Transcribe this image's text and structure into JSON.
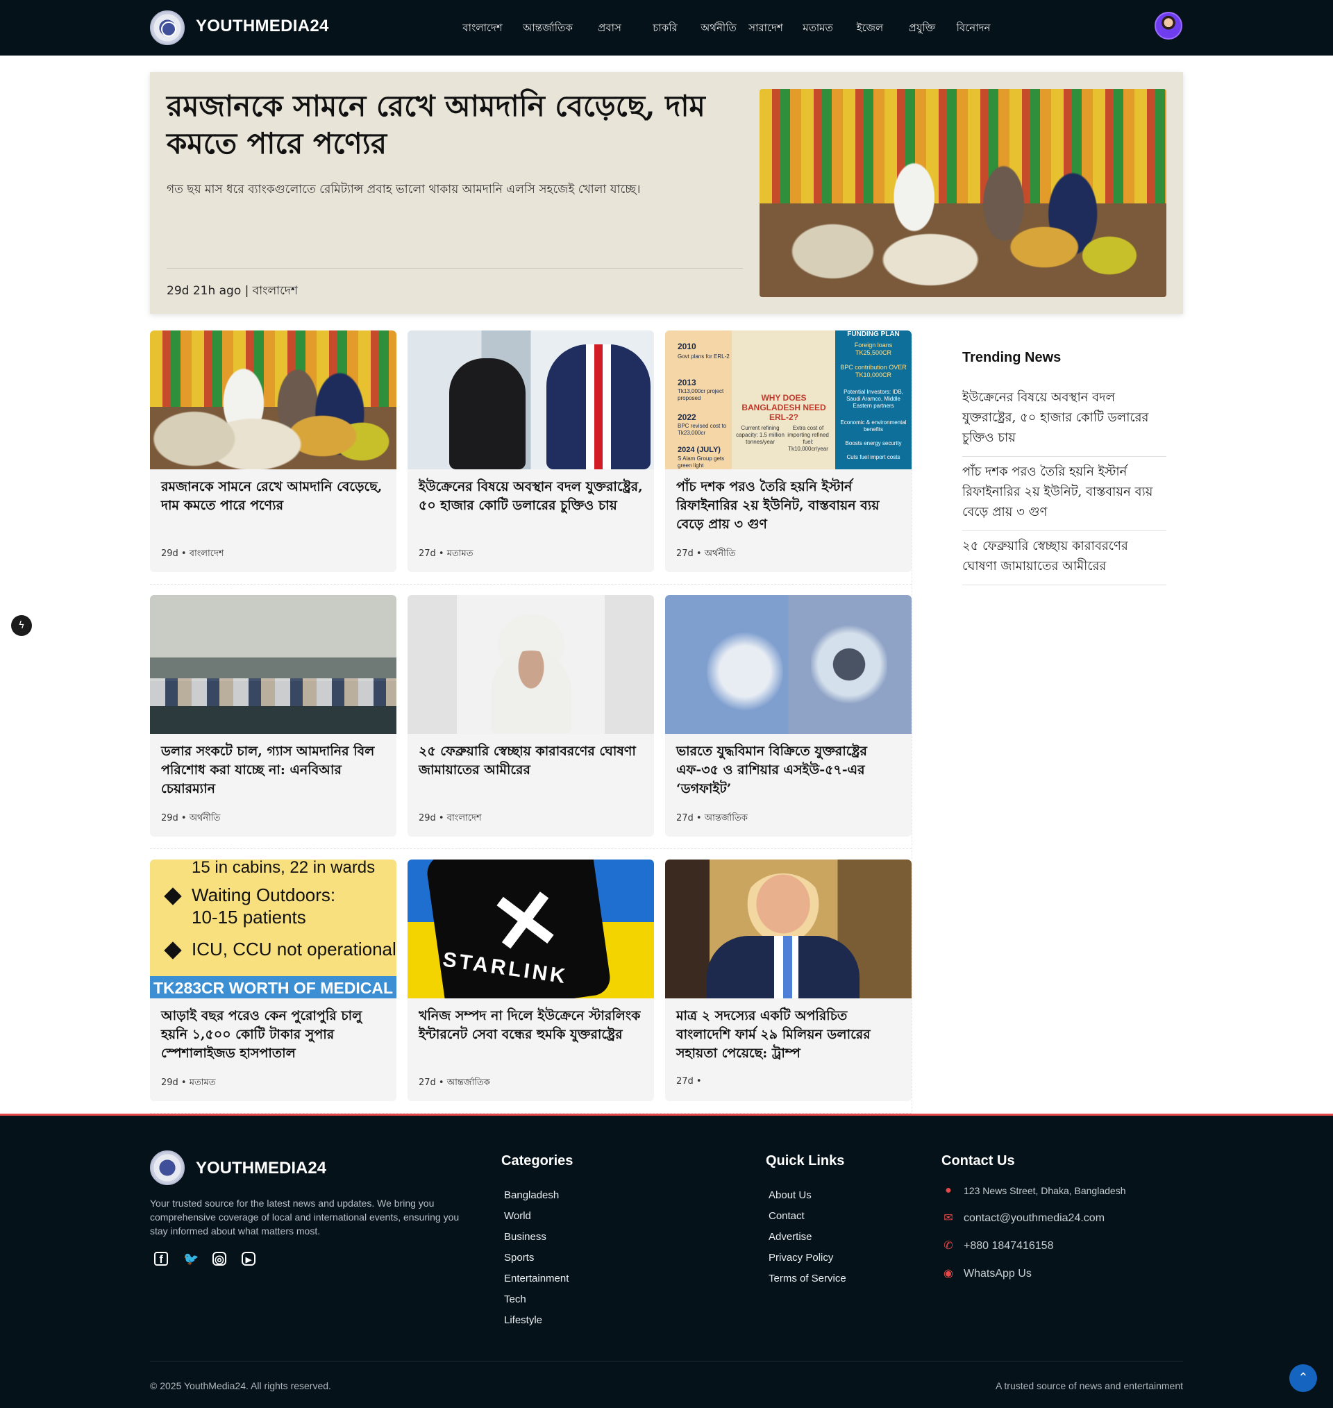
{
  "header": {
    "brand": "YOUTHMEDIA24",
    "menu": [
      "বাংলাদেশ",
      "আন্তর্জাতিক",
      "প্রবাস",
      "চাকরি",
      "অর্থনীতি",
      "সারাদেশ",
      "মতামত",
      "ইজেল",
      "প্রযুক্তি",
      "বিনোদন"
    ],
    "avatar_icon": "user-avatar"
  },
  "hero": {
    "title": "রমজানকে সামনে রেখে আমদানি বেড়েছে, দাম কমতে পারে পণ্যের",
    "summary": "গত ছয় মাস ধরে ব্যাংকগুলোতে রেমিট্যান্স প্রবাহ ভালো থাকায় আমদানি এলসি সহজেই খোলা যাচ্ছে।",
    "meta": "29d 21h ago | বাংলাদেশ"
  },
  "articles": [
    {
      "title": "রমজানকে সামনে রেখে আমদানি বেড়েছে, দাম কমতে পারে পণ্যের",
      "meta": "29d • বাংলাদেশ"
    },
    {
      "title": "ইউক্রেনের বিষয়ে অবস্থান বদল যুক্তরাষ্ট্রের, ৫০ হাজার কোটি ডলারের চুক্তিও চায়",
      "meta": "27d • মতামত"
    },
    {
      "title": "পাঁচ দশক পরও তৈরি হয়নি ইস্টার্ন রিফাইনারির ২য় ইউনিট, বাস্তবায়ন ব্যয় বেড়ে প্রায় ৩ গুণ",
      "meta": "27d • অর্থনীতি"
    },
    {
      "title": "ডলার সংকটে চাল, গ্যাস আমদানির বিল পরিশোধ করা যাচ্ছে না: এনবিআর চেয়ারম্যান",
      "meta": "29d • অর্থনীতি"
    },
    {
      "title": "২৫ ফেব্রুয়ারি স্বেচ্ছায় কারাবরণের ঘোষণা জামায়াতের আমীরের",
      "meta": "29d • বাংলাদেশ"
    },
    {
      "title": "ভারতে যুদ্ধবিমান বিক্রিতে যুক্তরাষ্ট্রের এফ-৩৫ ও রাশিয়ার এসইউ-৫৭-এর ‘ডগফাইট’",
      "meta": "27d • আন্তর্জাতিক"
    },
    {
      "title": "আড়াই বছর পরেও কেন পুরোপুরি চালু হয়নি ১,৫০০ কোটি টাকার সুপার স্পেশালাইজড হাসপাতাল",
      "meta": "29d • মতামত"
    },
    {
      "title": "খনিজ সম্পদ না দিলে ইউক্রেনে স্টারলিংক ইন্টারনেট সেবা বন্ধের হুমকি যুক্তরাষ্ট্রের",
      "meta": "27d • আন্তর্জাতিক"
    },
    {
      "title": "মাত্র ২ সদস্যের একটি অপরিচিত বাংলাদেশি ফার্ম ২৯ মিলিয়ন ডলারের সহায়তা পেয়েছে: ট্রাম্প",
      "meta": "27d •"
    }
  ],
  "image_text": {
    "erl": {
      "y2010": "2010",
      "y2010_note": "Govt plans for ERL-2",
      "y2013": "2013",
      "y2013_note": "Tk13,000cr project proposed",
      "y2022": "2022",
      "y2022_note": "BPC revised cost to Tk23,000cr",
      "y2024": "2024 (JULY)",
      "y2024_note": "S Alam Group gets green light",
      "question": "WHY DOES BANGLADESH NEED ERL-2?",
      "fact1": "Current refining capacity: 1.5 million tonnes/year",
      "fact2": "Extra cost of importing refined fuel: Tk10,000cr/year",
      "plan_head": "FUNDING PLAN",
      "plan1": "Foreign loans TK25,500CR",
      "plan2": "BPC contribution OVER TK10,000CR",
      "plan3": "Potential Investors: IDB, Saudi Aramco, Middle Eastern partners",
      "plan4": "Economic & environmental benefits",
      "plan5": "Boosts energy security",
      "plan6": "Cuts fuel import costs"
    },
    "hospital": {
      "line1": "15 in cabins, 22 in wards",
      "line2": "Waiting Outdoors:",
      "line3": "10-15 patients",
      "line4": "ICU, CCU not operational",
      "line5": "TK283CR WORTH OF MEDICAL"
    },
    "starlink": "STARLINK"
  },
  "sidebar": {
    "title": "Trending News",
    "items": [
      "ইউক্রেনের বিষয়ে অবস্থান বদল যুক্তরাষ্ট্রের, ৫০ হাজার কোটি ডলারের চুক্তিও চায়",
      "পাঁচ দশক পরও তৈরি হয়নি ইস্টার্ন রিফাইনারির ২য় ইউনিট, বাস্তবায়ন ব্যয় বেড়ে প্রায় ৩ গুণ",
      "২৫ ফেব্রুয়ারি স্বেচ্ছায় কারাবরণের ঘোষণা জামায়াতের আমীরের"
    ]
  },
  "footer": {
    "brand": "YOUTHMEDIA24",
    "description": "Your trusted source for the latest news and updates. We bring you comprehensive coverage of local and international events, ensuring you stay informed about what matters most.",
    "social_icons": [
      "facebook-icon",
      "twitter-icon",
      "instagram-icon",
      "youtube-icon"
    ],
    "categories_title": "Categories",
    "categories": [
      "Bangladesh",
      "World",
      "Business",
      "Sports",
      "Entertainment",
      "Tech",
      "Lifestyle"
    ],
    "quick_links_title": "Quick Links",
    "quick_links": [
      "About Us",
      "Contact",
      "Advertise",
      "Privacy Policy",
      "Terms of Service"
    ],
    "contact_title": "Contact Us",
    "address": "123 News Street, Dhaka, Bangladesh",
    "email": "contact@youthmedia24.com",
    "phone": "+880 1847416158",
    "whatsapp": "WhatsApp Us",
    "copyright": "© 2025 YouthMedia24. All rights reserved.",
    "tagline": "A trusted source of news and entertainment"
  },
  "colors": {
    "nav_bg": "#061219",
    "hero_bg": "#e8e4d8",
    "card_bg": "#f4f4f4",
    "accent_red": "#e44848",
    "to_top_blue": "#1565c0"
  }
}
